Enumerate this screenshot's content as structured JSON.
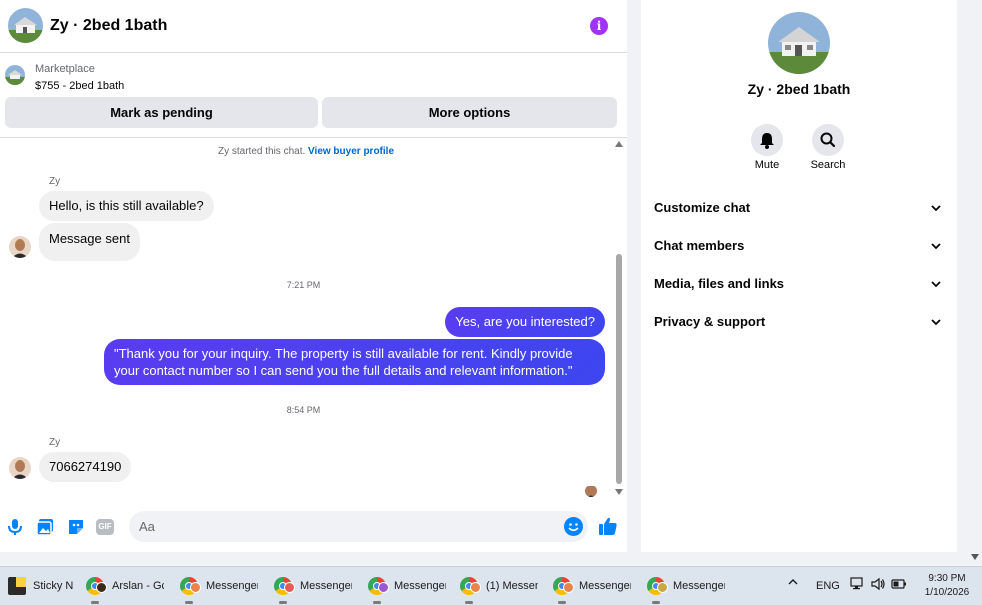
{
  "chat": {
    "title": "Zy · 2bed 1bath",
    "marketplace": {
      "label": "Marketplace",
      "price_line": "$755 - 2bed 1bath",
      "pending_button": "Mark as pending",
      "more_button": "More options"
    },
    "started_text": "Zy started this chat.",
    "buyer_profile_link": "View buyer profile",
    "messages": {
      "sender_1": "Zy",
      "incoming_1": "Hello, is this still available?",
      "incoming_2": "Message sent",
      "time_1": "7:21 PM",
      "outgoing_1": "Yes, are you interested?",
      "outgoing_2_line1": "\"Thank you for your inquiry. The property is still available for rent. Kindly provide",
      "outgoing_2_line2": "your contact number so I can send you the full details and relevant information.\"",
      "time_2": "8:54 PM",
      "sender_2": "Zy",
      "incoming_3": "7066274190"
    },
    "composer": {
      "placeholder": "Aa",
      "gif_label": "GIF"
    }
  },
  "info_panel": {
    "title": "Zy · 2bed 1bath",
    "mute_label": "Mute",
    "search_label": "Search",
    "sections": [
      {
        "label": "Customize chat"
      },
      {
        "label": "Chat members"
      },
      {
        "label": "Media, files and links"
      },
      {
        "label": "Privacy & support"
      }
    ]
  },
  "taskbar": {
    "items": [
      {
        "label": "Sticky N",
        "icon": "sticky-notes-icon"
      },
      {
        "label": "Arslan - Gc",
        "icon": "chrome-icon"
      },
      {
        "label": "Messenger",
        "icon": "chrome-icon"
      },
      {
        "label": "Messenger",
        "icon": "chrome-icon"
      },
      {
        "label": "Messenger",
        "icon": "chrome-icon"
      },
      {
        "label": "(1) Messen",
        "icon": "chrome-icon"
      },
      {
        "label": "Messenger",
        "icon": "chrome-icon"
      },
      {
        "label": "Messenger",
        "icon": "chrome-icon"
      }
    ],
    "language": "ENG",
    "time": "9:30 PM",
    "date": "1/10/2026"
  },
  "colors": {
    "accent": "#0084ff",
    "outgoing_bubble": "#4a40f0",
    "info_icon": "#a033ff",
    "link": "#0064d1"
  }
}
